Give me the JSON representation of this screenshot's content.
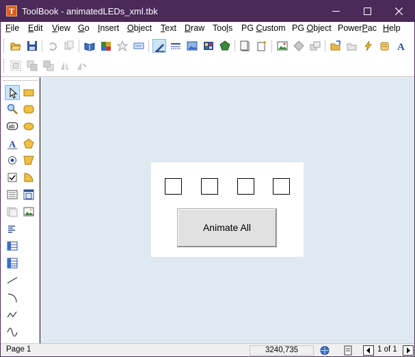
{
  "window": {
    "title": "ToolBook - animatedLEDs_xml.tbk",
    "app_icon_letter": "T"
  },
  "menu": {
    "items": [
      {
        "label": "File",
        "key": "F",
        "rest": "ile"
      },
      {
        "label": "Edit",
        "key": "E",
        "rest": "dit"
      },
      {
        "label": "View",
        "key": "V",
        "rest": "iew"
      },
      {
        "label": "Go",
        "key": "G",
        "rest": "o"
      },
      {
        "label": "Insert",
        "key": "I",
        "rest": "nsert"
      },
      {
        "label": "Object",
        "key": "O",
        "rest": "bject"
      },
      {
        "label": "Text",
        "key": "T",
        "rest": "ext"
      },
      {
        "label": "Draw",
        "key": "D",
        "rest": "raw"
      },
      {
        "label": "Tools",
        "pre": "Too",
        "key": "l",
        "rest": "s"
      },
      {
        "label": "PG Custom",
        "pre": "PG ",
        "key": "C",
        "rest": "ustom"
      },
      {
        "label": "PG Object",
        "pre": "PG ",
        "key": "O",
        "rest": "bject"
      },
      {
        "label": "PowerPac",
        "pre": "Power",
        "key": "P",
        "rest": "ac"
      },
      {
        "label": "Help",
        "key": "H",
        "rest": "elp"
      }
    ]
  },
  "toolbar": {
    "text_tool_glyph": "A"
  },
  "palette": {
    "field_glyph": "ab",
    "text_glyph": "A"
  },
  "page": {
    "led_count": 4,
    "animate_button_label": "Animate All"
  },
  "status": {
    "page_label": "Page 1",
    "coordinates": "3240,735",
    "page_counter": "1 of 1"
  }
}
